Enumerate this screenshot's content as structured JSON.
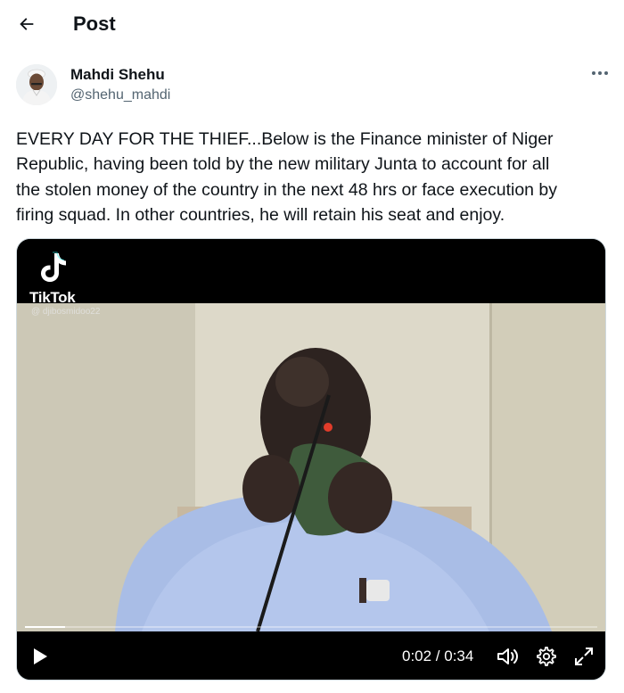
{
  "header": {
    "title": "Post",
    "back_icon": "arrow-left-icon"
  },
  "author": {
    "name": "Mahdi Shehu",
    "handle": "@shehu_mahdi",
    "more_icon": "more-horizontal-icon"
  },
  "tweet": {
    "lines": [
      "EVERY DAY FOR THE THIEF...Below is the Finance minister of Niger",
      "Republic, having been told by the new military Junta to account for all",
      "the stolen money of the country in the next 48 hrs or face execution by",
      "firing squad. In other countries, he will retain his seat and enjoy."
    ]
  },
  "video": {
    "watermark": "TikTok",
    "watermark_user": "@ djibosmidoo22",
    "current_time": "0:02",
    "duration": "0:34",
    "time_display": "0:02 / 0:34",
    "progress_fraction": 0.07,
    "controls": {
      "play_icon": "play-icon",
      "volume_icon": "volume-icon",
      "settings_icon": "settings-gear-icon",
      "fullscreen_icon": "fullscreen-icon"
    }
  },
  "colors": {
    "text_primary": "#0f1419",
    "text_secondary": "#536471",
    "media_border": "#cfd9de"
  }
}
